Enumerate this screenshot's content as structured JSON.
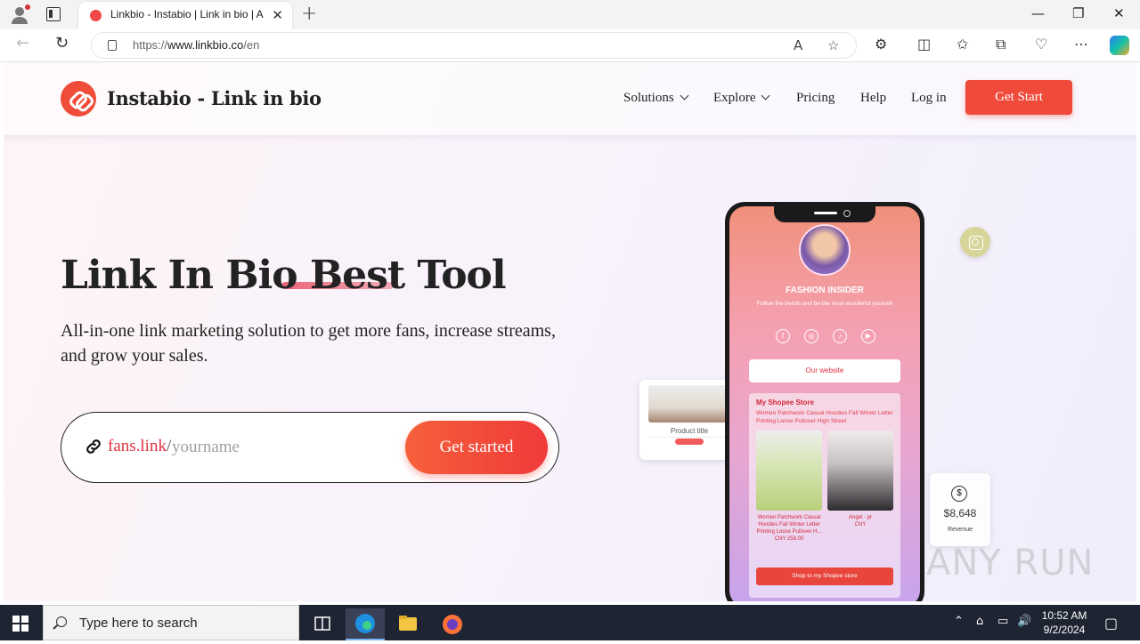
{
  "browser": {
    "tab_title": "Linkbio - Instabio | Link in bio | A",
    "url_prefix": "https://",
    "url_host": "www.linkbio.co",
    "url_path": "/en"
  },
  "site": {
    "brand": "Instabio - Link in bio",
    "nav": {
      "solutions": "Solutions",
      "explore": "Explore",
      "pricing": "Pricing",
      "help": "Help",
      "login": "Log in",
      "get_start": "Get Start"
    },
    "hero": {
      "title": "Link In Bio Best Tool",
      "subtitle": "All-in-one link marketing solution to get more fans, increase streams, and grow your sales.",
      "domain": "fans.link",
      "slash": "/",
      "input_placeholder": "yourname",
      "cta": "Get started"
    },
    "phone": {
      "profile_name": "FASHION INSIDER",
      "profile_desc": "Follow the trends and be the most wonderful yourself",
      "website_button": "Our website",
      "store_title": "My Shopee Store",
      "store_text": "Women Patchwork Casual Hoodies Fall Winter Letter Printing Loose Pullover High Street",
      "product_1_caption": "Women Patchwork Casual Hoodies Fall Winter Letter Printing Loose Pullover H...",
      "product_1_price": "CNY 258.00",
      "product_2_caption": "Angel · pr",
      "product_2_price": "CNY",
      "shop_button": "Shop to my Shopee store"
    },
    "product_card": {
      "title": "Product title"
    },
    "revenue_card": {
      "value": "$8,648",
      "label": "Revenue"
    },
    "watermark": "ANY RUN"
  },
  "taskbar": {
    "search_placeholder": "Type here to search",
    "time": "10:52 AM",
    "date": "9/2/2024"
  },
  "colors": {
    "accent": "#f04a3a",
    "domain_red": "#e0303f"
  }
}
